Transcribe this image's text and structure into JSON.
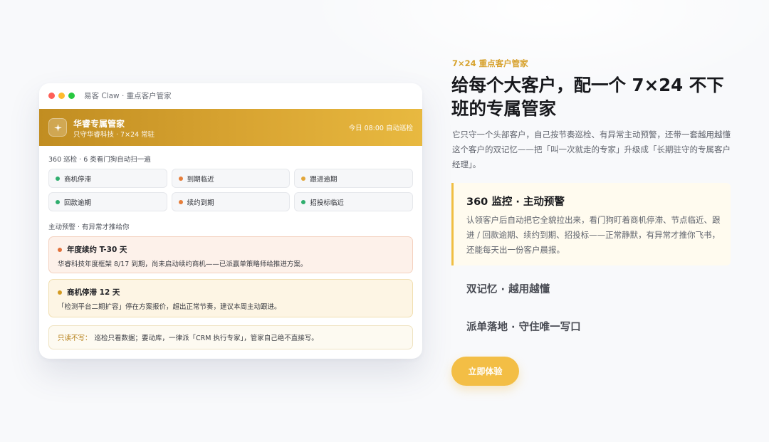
{
  "window": {
    "title": "易客 Claw · 重点客户管家",
    "hero": {
      "name": "华睿专属管家",
      "subtitle": "只守华睿科技 · 7×24 常驻",
      "status": "今日 08:00 自动巡检"
    },
    "scan_label": "360 巡检 · 6 类看门狗自动扫一遍",
    "watchdogs": [
      {
        "label": "商机停滞",
        "color": "#2fae6e"
      },
      {
        "label": "到期临近",
        "color": "#e67e3b"
      },
      {
        "label": "跟进逾期",
        "color": "#e2a63a"
      },
      {
        "label": "回款逾期",
        "color": "#2fae6e"
      },
      {
        "label": "续约到期",
        "color": "#e67e3b"
      },
      {
        "label": "招投标临近",
        "color": "#2fae6e"
      }
    ],
    "alerts_label": "主动预警 · 有异常才推给你",
    "alerts": [
      {
        "title": "年度续约 T-30 天",
        "body": "华睿科技年度框架 8/17 到期，尚未启动续约商机——已派赢单策略师给推进方案。",
        "color": "#e2703a"
      },
      {
        "title": "商机停滞 12 天",
        "body": "「检测平台二期扩容」停在方案报价，超出正常节奏，建议本周主动跟进。",
        "color": "#d39a21"
      }
    ],
    "note": {
      "label": "只读不写：",
      "text": "巡检只看数据；要动库，一律派「CRM 执行专家」，管家自己绝不直接写。"
    }
  },
  "aside": {
    "eyebrow": "7×24 重点客户管家",
    "headline": "给每个大客户，配一个 7×24 不下班的专属管家",
    "description": "它只守一个头部客户，自己按节奏巡检、有异常主动预警，还带一套越用越懂这个客户的双记忆——把「叫一次就走的专家」升级成「长期驻守的专属客户经理」。",
    "features": [
      {
        "title": "360 监控 · 主动预警",
        "body": "认领客户后自动把它全貌拉出来，看门狗盯着商机停滞、节点临近、跟进 / 回款逾期、续约到期、招投标——正常静默，有异常才推你飞书，还能每天出一份客户晨报。"
      },
      {
        "title": "双记忆 · 越用越懂"
      },
      {
        "title": "派单落地 · 守住唯一写口"
      }
    ],
    "cta_label": "立即体验"
  },
  "colors": {
    "accent": "#f3be45",
    "hero_gradient_start": "#c18d21",
    "hero_gradient_end": "#e8b940"
  }
}
